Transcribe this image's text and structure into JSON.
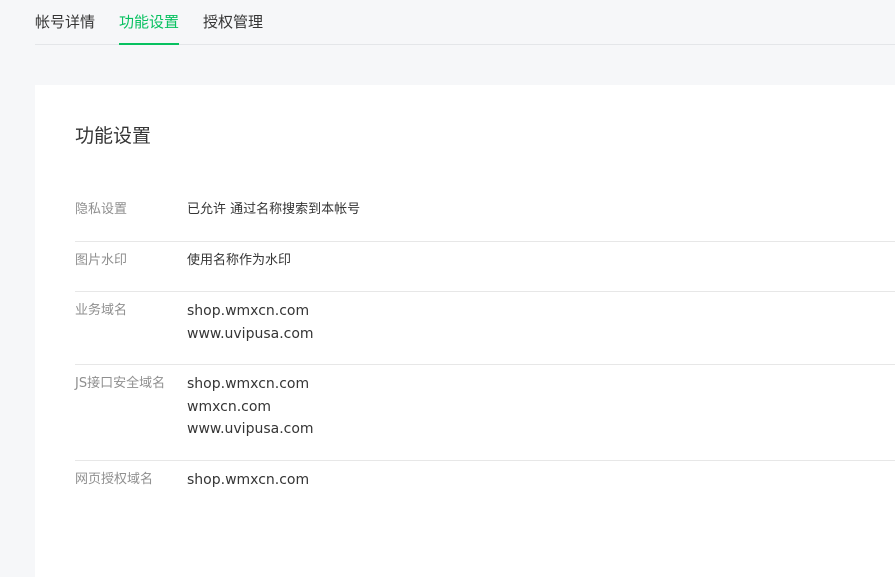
{
  "tabs": [
    {
      "label": "帐号详情",
      "active": false
    },
    {
      "label": "功能设置",
      "active": true
    },
    {
      "label": "授权管理",
      "active": false
    }
  ],
  "colors": {
    "accent": "#07c160",
    "background": "#f6f7f9",
    "card": "#ffffff",
    "label": "#8f8f8f",
    "text": "#353535"
  },
  "card": {
    "title": "功能设置",
    "rows": [
      {
        "label": "隐私设置",
        "values": [
          "已允许 通过名称搜索到本帐号"
        ]
      },
      {
        "label": "图片水印",
        "values": [
          "使用名称作为水印"
        ]
      },
      {
        "label": "业务域名",
        "values": [
          "shop.wmxcn.com",
          "www.uvipusa.com"
        ]
      },
      {
        "label": "JS接口安全域名",
        "values": [
          "shop.wmxcn.com",
          "wmxcn.com",
          "www.uvipusa.com"
        ]
      },
      {
        "label": "网页授权域名",
        "values": [
          "shop.wmxcn.com"
        ]
      }
    ]
  }
}
